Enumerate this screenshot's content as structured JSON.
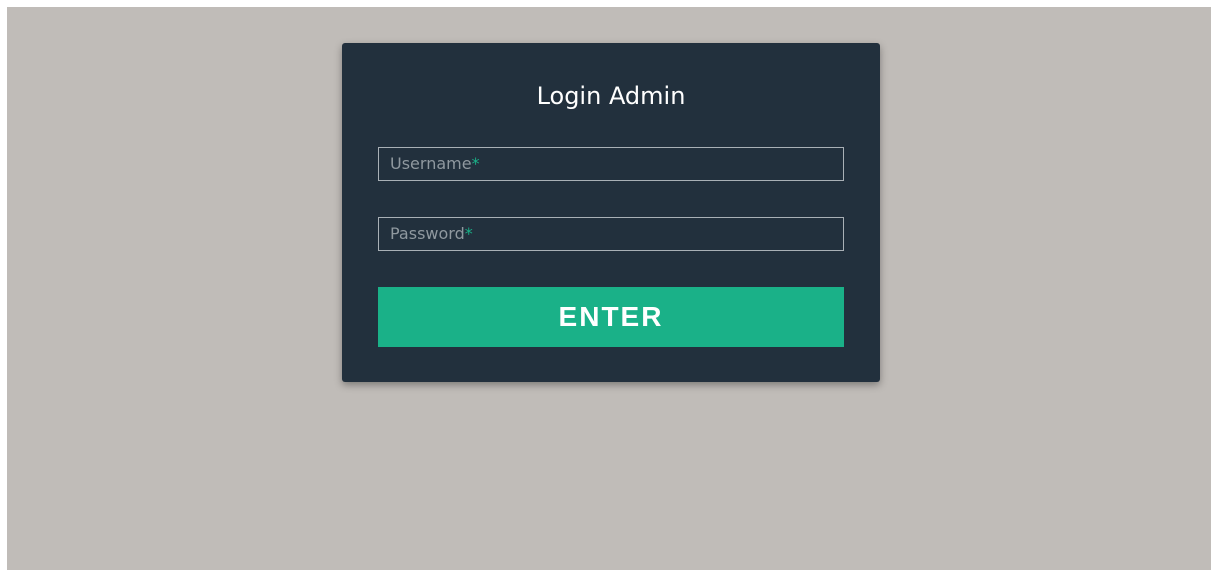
{
  "login": {
    "title": "Login Admin",
    "username": {
      "label": "Username",
      "required_mark": "*",
      "value": ""
    },
    "password": {
      "label": "Password",
      "required_mark": "*",
      "value": ""
    },
    "enter_label": "ENTER"
  },
  "colors": {
    "background": "#c0bcb8",
    "card": "#22303d",
    "accent": "#1ab188",
    "field_border": "#a9b0b6",
    "placeholder_text": "#8f989f"
  }
}
